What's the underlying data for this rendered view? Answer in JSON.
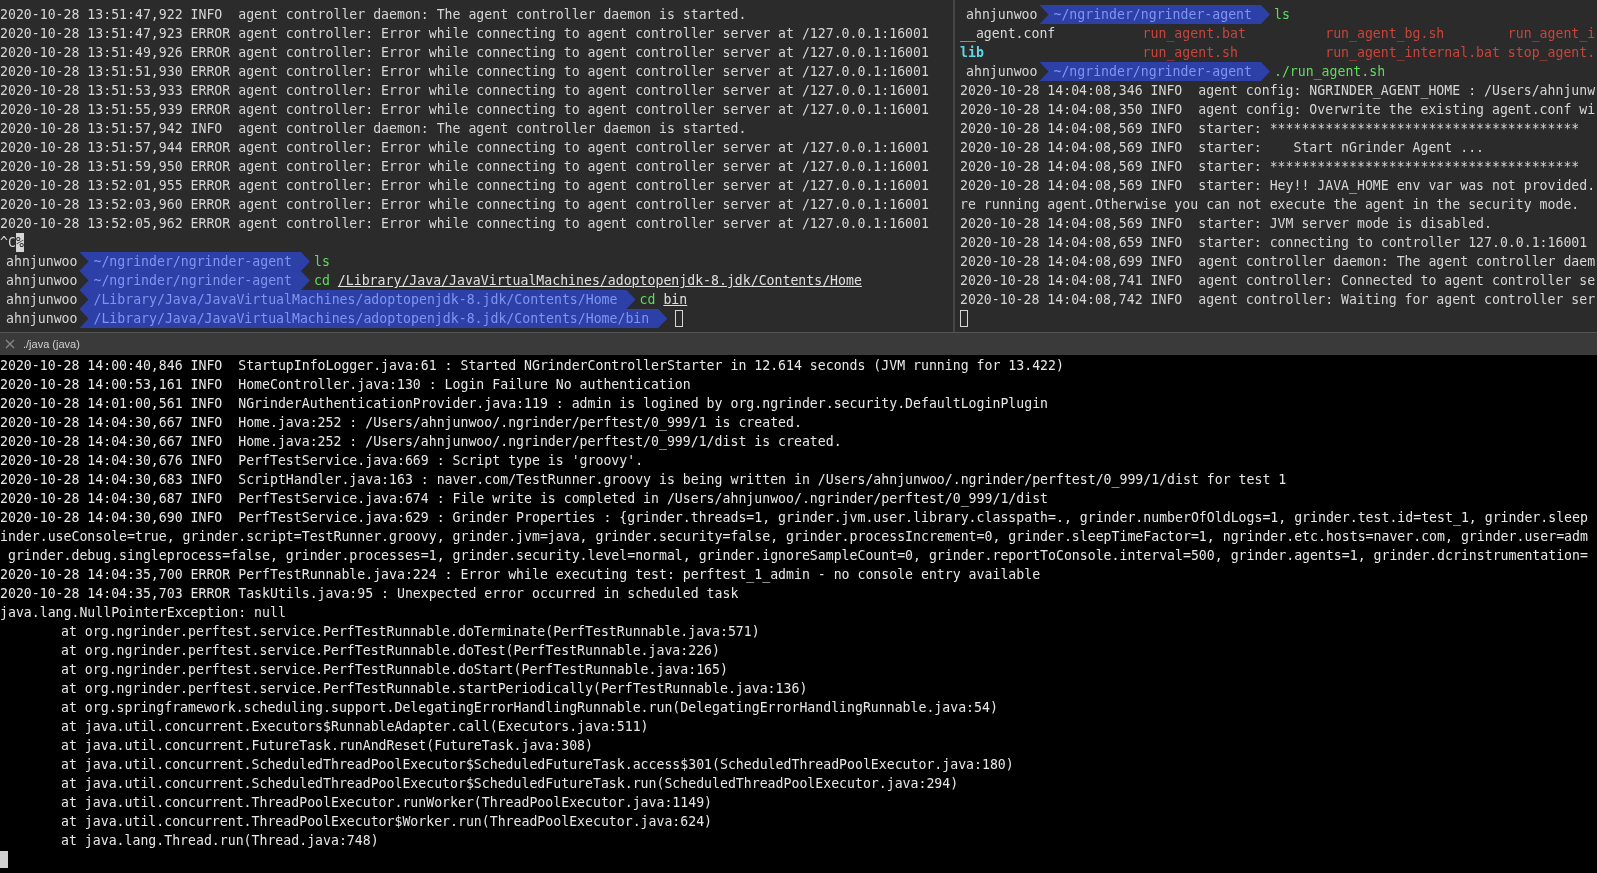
{
  "top_left_pane": {
    "lines": [
      {
        "kind": "log",
        "text": "2020-10-28 13:51:47,922 INFO  agent controller daemon: The agent controller daemon is started."
      },
      {
        "kind": "log",
        "text": "2020-10-28 13:51:47,923 ERROR agent controller: Error while connecting to agent controller server at /127.0.0.1:16001"
      },
      {
        "kind": "log",
        "text": "2020-10-28 13:51:49,926 ERROR agent controller: Error while connecting to agent controller server at /127.0.0.1:16001"
      },
      {
        "kind": "log",
        "text": "2020-10-28 13:51:51,930 ERROR agent controller: Error while connecting to agent controller server at /127.0.0.1:16001"
      },
      {
        "kind": "log",
        "text": "2020-10-28 13:51:53,933 ERROR agent controller: Error while connecting to agent controller server at /127.0.0.1:16001"
      },
      {
        "kind": "log",
        "text": "2020-10-28 13:51:55,939 ERROR agent controller: Error while connecting to agent controller server at /127.0.0.1:16001"
      },
      {
        "kind": "log",
        "text": "2020-10-28 13:51:57,942 INFO  agent controller daemon: The agent controller daemon is started."
      },
      {
        "kind": "log",
        "text": "2020-10-28 13:51:57,944 ERROR agent controller: Error while connecting to agent controller server at /127.0.0.1:16001"
      },
      {
        "kind": "log",
        "text": "2020-10-28 13:51:59,950 ERROR agent controller: Error while connecting to agent controller server at /127.0.0.1:16001"
      },
      {
        "kind": "log",
        "text": "2020-10-28 13:52:01,955 ERROR agent controller: Error while connecting to agent controller server at /127.0.0.1:16001"
      },
      {
        "kind": "log",
        "text": "2020-10-28 13:52:03,960 ERROR agent controller: Error while connecting to agent controller server at /127.0.0.1:16001"
      },
      {
        "kind": "log",
        "text": "2020-10-28 13:52:05,962 ERROR agent controller: Error while connecting to agent controller server at /127.0.0.1:16001"
      },
      {
        "kind": "interrupt",
        "text": "^C",
        "mark": "%"
      },
      {
        "kind": "prompt",
        "user": "ahnjunwoo",
        "path": "~/ngrinder/ngrinder-agent",
        "command": "ls"
      },
      {
        "kind": "prompt",
        "user": "ahnjunwoo",
        "path": "~/ngrinder/ngrinder-agent",
        "command": "cd",
        "argument": "/Library/Java/JavaVirtualMachines/adoptopenjdk-8.jdk/Contents/Home"
      },
      {
        "kind": "prompt",
        "user": "ahnjunwoo",
        "path": "/Library/Java/JavaVirtualMachines/adoptopenjdk-8.jdk/Contents/Home",
        "command": "cd",
        "argument": "bin"
      },
      {
        "kind": "prompt",
        "user": "ahnjunwoo",
        "path": "/Library/Java/JavaVirtualMachines/adoptopenjdk-8.jdk/Contents/Home/bin",
        "cursor": true
      }
    ]
  },
  "top_right_pane": {
    "lines": [
      {
        "kind": "prompt",
        "user": "ahnjunwoo",
        "path": "~/ngrinder/ngrinder-agent",
        "command": "ls"
      },
      {
        "kind": "ls",
        "entries": [
          {
            "name": "__agent.conf",
            "kind": "file",
            "color": "#d8d8d8"
          },
          {
            "name": "run_agent.bat",
            "kind": "file",
            "color": "#c9443a"
          },
          {
            "name": "run_agent_bg.sh",
            "kind": "file",
            "color": "#c9443a"
          },
          {
            "name": "run_agent_i",
            "kind": "file",
            "color": "#c9443a"
          }
        ]
      },
      {
        "kind": "ls",
        "entries": [
          {
            "name": "lib",
            "kind": "dir",
            "color": "#5fd7e6"
          },
          {
            "name": "run_agent.sh",
            "kind": "file",
            "color": "#c9443a"
          },
          {
            "name": "run_agent_internal.bat",
            "kind": "file",
            "color": "#c9443a"
          },
          {
            "name": "stop_agent.",
            "kind": "file",
            "color": "#c9443a"
          }
        ]
      },
      {
        "kind": "prompt",
        "user": "ahnjunwoo",
        "path": "~/ngrinder/ngrinder-agent",
        "command": "./run_agent.sh"
      },
      {
        "kind": "log",
        "text": "2020-10-28 14:04:08,346 INFO  agent config: NGRINDER_AGENT_HOME : /Users/ahnjunw"
      },
      {
        "kind": "log",
        "text": "2020-10-28 14:04:08,350 INFO  agent config: Overwrite the existing agent.conf wi"
      },
      {
        "kind": "log",
        "text": "2020-10-28 14:04:08,569 INFO  starter: ***************************************"
      },
      {
        "kind": "log",
        "text": "2020-10-28 14:04:08,569 INFO  starter:    Start nGrinder Agent ..."
      },
      {
        "kind": "log",
        "text": "2020-10-28 14:04:08,569 INFO  starter: ***************************************"
      },
      {
        "kind": "log",
        "text": "2020-10-28 14:04:08,569 INFO  starter: Hey!! JAVA_HOME env var was not provided."
      },
      {
        "kind": "log",
        "text": "re running agent.Otherwise you can not execute the agent in the security mode."
      },
      {
        "kind": "log",
        "text": "2020-10-28 14:04:08,569 INFO  starter: JVM server mode is disabled."
      },
      {
        "kind": "log",
        "text": "2020-10-28 14:04:08,659 INFO  starter: connecting to controller 127.0.0.1:16001"
      },
      {
        "kind": "log",
        "text": "2020-10-28 14:04:08,699 INFO  agent controller daemon: The agent controller daem"
      },
      {
        "kind": "log",
        "text": "2020-10-28 14:04:08,741 INFO  agent controller: Connected to agent controller se"
      },
      {
        "kind": "log",
        "text": "2020-10-28 14:04:08,742 INFO  agent controller: Waiting for agent controller ser"
      },
      {
        "kind": "cursor"
      }
    ]
  },
  "bottom_tab": {
    "label": "./java (java)"
  },
  "bottom_pane": {
    "lines": [
      {
        "kind": "log",
        "text": "2020-10-28 14:00:40,846 INFO  StartupInfoLogger.java:61 : Started NGrinderControllerStarter in 12.614 seconds (JVM running for 13.422)"
      },
      {
        "kind": "log",
        "text": "2020-10-28 14:00:53,161 INFO  HomeController.java:130 : Login Failure No authentication"
      },
      {
        "kind": "log",
        "text": "2020-10-28 14:01:00,561 INFO  NGrinderAuthenticationProvider.java:119 : admin is logined by org.ngrinder.security.DefaultLoginPlugin"
      },
      {
        "kind": "log",
        "text": "2020-10-28 14:04:30,667 INFO  Home.java:252 : /Users/ahnjunwoo/.ngrinder/perftest/0_999/1 is created."
      },
      {
        "kind": "log",
        "text": "2020-10-28 14:04:30,667 INFO  Home.java:252 : /Users/ahnjunwoo/.ngrinder/perftest/0_999/1/dist is created."
      },
      {
        "kind": "log",
        "text": "2020-10-28 14:04:30,676 INFO  PerfTestService.java:669 : Script type is 'groovy'."
      },
      {
        "kind": "log",
        "text": "2020-10-28 14:04:30,683 INFO  ScriptHandler.java:163 : naver.com/TestRunner.groovy is being written in /Users/ahnjunwoo/.ngrinder/perftest/0_999/1/dist for test 1"
      },
      {
        "kind": "log",
        "text": "2020-10-28 14:04:30,687 INFO  PerfTestService.java:674 : File write is completed in /Users/ahnjunwoo/.ngrinder/perftest/0_999/1/dist"
      },
      {
        "kind": "log",
        "text": "2020-10-28 14:04:30,690 INFO  PerfTestService.java:629 : Grinder Properties : {grinder.threads=1, grinder.jvm.user.library.classpath=., grinder.numberOfOldLogs=1, grinder.test.id=test_1, grinder.sleep"
      },
      {
        "kind": "log",
        "text": "inder.useConsole=true, grinder.script=TestRunner.groovy, grinder.jvm=java, grinder.security=false, grinder.processIncrement=0, grinder.sleepTimeFactor=1, ngrinder.etc.hosts=naver.com, grinder.user=adm"
      },
      {
        "kind": "log",
        "text": " grinder.debug.singleprocess=false, grinder.processes=1, grinder.security.level=normal, grinder.ignoreSampleCount=0, grinder.reportToConsole.interval=500, grinder.agents=1, grinder.dcrinstrumentation="
      },
      {
        "kind": "log",
        "text": "2020-10-28 14:04:35,700 ERROR PerfTestRunnable.java:224 : Error while executing test: perftest_1_admin - no console entry available"
      },
      {
        "kind": "log",
        "text": "2020-10-28 14:04:35,703 ERROR TaskUtils.java:95 : Unexpected error occurred in scheduled task"
      },
      {
        "kind": "log",
        "text": "java.lang.NullPointerException: null"
      },
      {
        "kind": "stack",
        "text": "at org.ngrinder.perftest.service.PerfTestRunnable.doTerminate(PerfTestRunnable.java:571)"
      },
      {
        "kind": "stack",
        "text": "at org.ngrinder.perftest.service.PerfTestRunnable.doTest(PerfTestRunnable.java:226)"
      },
      {
        "kind": "stack",
        "text": "at org.ngrinder.perftest.service.PerfTestRunnable.doStart(PerfTestRunnable.java:165)"
      },
      {
        "kind": "stack",
        "text": "at org.ngrinder.perftest.service.PerfTestRunnable.startPeriodically(PerfTestRunnable.java:136)"
      },
      {
        "kind": "stack",
        "text": "at org.springframework.scheduling.support.DelegatingErrorHandlingRunnable.run(DelegatingErrorHandlingRunnable.java:54)"
      },
      {
        "kind": "stack",
        "text": "at java.util.concurrent.Executors$RunnableAdapter.call(Executors.java:511)"
      },
      {
        "kind": "stack",
        "text": "at java.util.concurrent.FutureTask.runAndReset(FutureTask.java:308)"
      },
      {
        "kind": "stack",
        "text": "at java.util.concurrent.ScheduledThreadPoolExecutor$ScheduledFutureTask.access$301(ScheduledThreadPoolExecutor.java:180)"
      },
      {
        "kind": "stack",
        "text": "at java.util.concurrent.ScheduledThreadPoolExecutor$ScheduledFutureTask.run(ScheduledThreadPoolExecutor.java:294)"
      },
      {
        "kind": "stack",
        "text": "at java.util.concurrent.ThreadPoolExecutor.runWorker(ThreadPoolExecutor.java:1149)"
      },
      {
        "kind": "stack",
        "text": "at java.util.concurrent.ThreadPoolExecutor$Worker.run(ThreadPoolExecutor.java:624)"
      },
      {
        "kind": "stack",
        "text": "at java.lang.Thread.run(Thread.java:748)"
      },
      {
        "kind": "cursor"
      }
    ]
  }
}
